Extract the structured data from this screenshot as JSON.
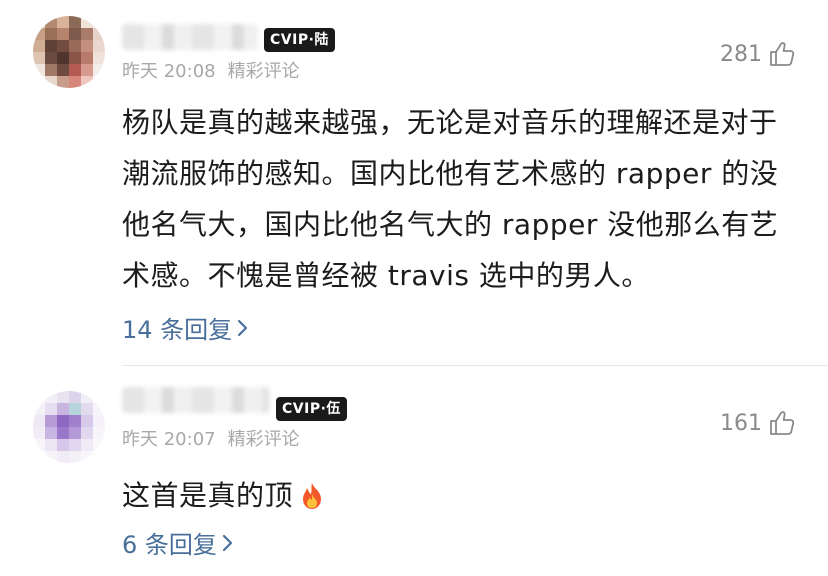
{
  "comments": [
    {
      "badge": "CVIP·陆",
      "date": "昨天 20:08",
      "tag": "精彩评论",
      "likes": "281",
      "text": "杨队是真的越来越强，无论是对音乐的理解还是对于潮流服饰的感知。国内比他有艺术感的 rapper 的没他名气大，国内比他名气大的 rapper 没他那么有艺术感。不愧是曾经被 travis 选中的男人。",
      "replies": "14 条回复"
    },
    {
      "badge": "CVIP·伍",
      "date": "昨天 20:07",
      "tag": "精彩评论",
      "likes": "161",
      "text": "这首是真的顶",
      "emoji": "fire-emoji",
      "replies": "6 条回复"
    }
  ],
  "colors": {
    "reply_link": "#486f9a",
    "meta_gray": "#a8a8a8",
    "badge_bg": "#1a1a1a"
  }
}
